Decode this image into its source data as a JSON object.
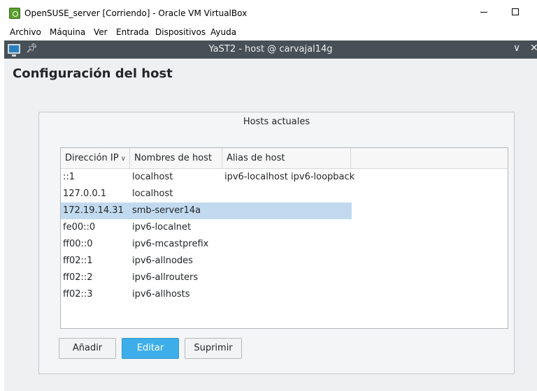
{
  "virtualbox": {
    "title": "OpenSUSE_server [Corriendo] - Oracle VM VirtualBox",
    "menu": [
      "Archivo",
      "Máquina",
      "Ver",
      "Entrada",
      "Dispositivos",
      "Ayuda"
    ]
  },
  "yast": {
    "window_title": "YaST2 - host @ carvajal14g",
    "page_title": "Configuración del host",
    "group_title": "Hosts actuales",
    "columns": [
      "Dirección IP",
      "Nombres de host",
      "Alias de host"
    ],
    "rows": [
      {
        "ip": "::1",
        "name": "localhost",
        "alias": "ipv6-localhost ipv6-loopback"
      },
      {
        "ip": "127.0.0.1",
        "name": "localhost",
        "alias": ""
      },
      {
        "ip": "172.19.14.31",
        "name": "smb-server14a",
        "alias": ""
      },
      {
        "ip": "fe00::0",
        "name": "ipv6-localnet",
        "alias": ""
      },
      {
        "ip": "ff00::0",
        "name": "ipv6-mcastprefix",
        "alias": ""
      },
      {
        "ip": "ff02::1",
        "name": "ipv6-allnodes",
        "alias": ""
      },
      {
        "ip": "ff02::2",
        "name": "ipv6-allrouters",
        "alias": ""
      },
      {
        "ip": "ff02::3",
        "name": "ipv6-allhosts",
        "alias": ""
      }
    ],
    "selected_row": 2,
    "buttons": {
      "add": "Añadir",
      "edit": "Editar",
      "delete": "Suprimir"
    }
  },
  "colors": {
    "titlebar": "#475057",
    "selection": "#c2daef",
    "accent": "#3daee9"
  },
  "icons": [
    "virtualbox-icon",
    "minimize-icon",
    "maximize-icon",
    "monitor-icon",
    "pin-icon",
    "chevron-down-icon",
    "close-icon",
    "sort-chevron-icon"
  ]
}
